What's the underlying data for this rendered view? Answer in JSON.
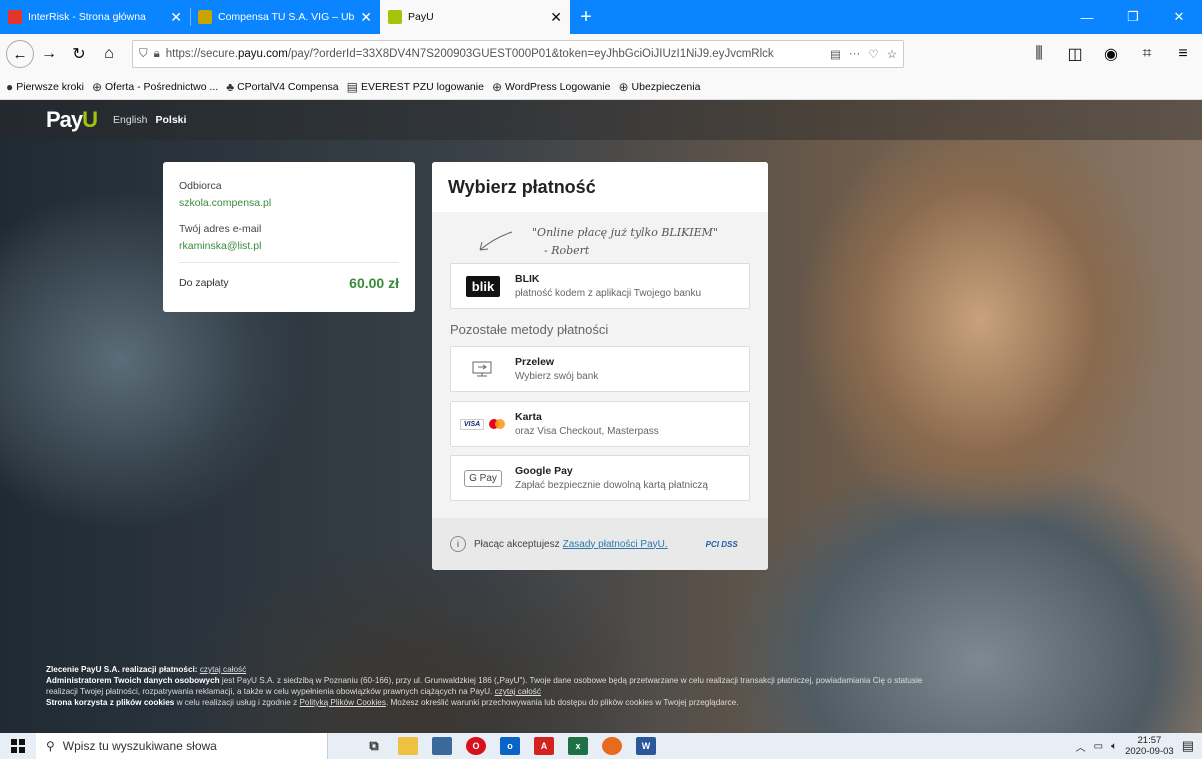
{
  "browser": {
    "tabs": [
      {
        "title": "InterRisk - Strona główna",
        "favicon_color": "#e4352b",
        "active": false
      },
      {
        "title": "Compensa TU S.A. VIG – Ubezp",
        "favicon_color": "#c8a400",
        "active": false
      },
      {
        "title": "PayU",
        "favicon_color": "#a6c307",
        "active": true
      }
    ],
    "url_prefix": "https://secure.",
    "url_domain": "payu.com",
    "url_rest": "/pay/?orderId=33X8DV4N7S200903GUEST000P01&token=eyJhbGciOiJIUzI1NiJ9.eyJvcmRlck",
    "bookmarks": [
      "Pierwsze kroki",
      "Oferta - Pośrednictwo ...",
      "CPortalV4 Compensa",
      "EVEREST PZU logowanie",
      "WordPress Logowanie",
      "Ubezpieczenia"
    ]
  },
  "header": {
    "logo_main": "Pay",
    "logo_accent": "U",
    "lang_en": "English",
    "lang_pl": "Polski"
  },
  "order": {
    "recipient_label": "Odbiorca",
    "recipient_value": "szkola.compensa.pl",
    "email_label": "Twój adres e-mail",
    "email_value": "rkaminska@list.pl",
    "amount_label": "Do zapłaty",
    "amount_value": "60.00 zł"
  },
  "payment": {
    "title": "Wybierz płatność",
    "quote_line1": "\"Online płacę już tylko BLIKIEM\"",
    "quote_line2": "- Robert",
    "blik_logo": "blik",
    "blik_title": "BLIK",
    "blik_sub": "płatność kodem z aplikacji Twojego banku",
    "other_heading": "Pozostałe metody płatności",
    "transfer_title": "Przelew",
    "transfer_sub": "Wybierz swój bank",
    "card_title": "Karta",
    "card_sub": "oraz Visa Checkout, Masterpass",
    "visa_text": "VISA",
    "gpay_logo": "G Pay",
    "gpay_title": "Google Pay",
    "gpay_sub": "Zapłać bezpiecznie dowolną kartą płatniczą",
    "footer_text": "Płacąc akceptujesz",
    "footer_link": "Zasady płatności PayU.",
    "pci_text": "PCI DSS"
  },
  "legal": {
    "l1_bold": "Zlecenie PayU S.A. realizacji płatności:",
    "l1_link": "czytaj całość",
    "l2_bold": "Administratorem Twoich danych osobowych",
    "l2_text": " jest PayU S.A. z siedzibą w Poznaniu (60-166), przy ul. Grunwaldzkiej 186 („PayU\"). Twoje dane osobowe będą przetwarzane w celu realizacji transakcji płatniczej, powiadamiania Cię o statusie realizacji Twojej płatności, rozpatrywania reklamacji, a także w celu wypełnienia obowiązków prawnych ciążących na PayU.",
    "l2_link": "czytaj całość",
    "l3_bold": "Strona korzysta z plików cookies",
    "l3_text": " w celu realizacji usług i zgodnie z",
    "l3_link": "Polityką Plików Cookies",
    "l3_text2": ". Możesz określić warunki przechowywania lub dostępu do plików cookies w Twojej przeglądarce."
  },
  "taskbar": {
    "search_placeholder": "Wpisz tu wyszukiwane słowa",
    "time": "21:57",
    "date": "2020-09-03"
  }
}
